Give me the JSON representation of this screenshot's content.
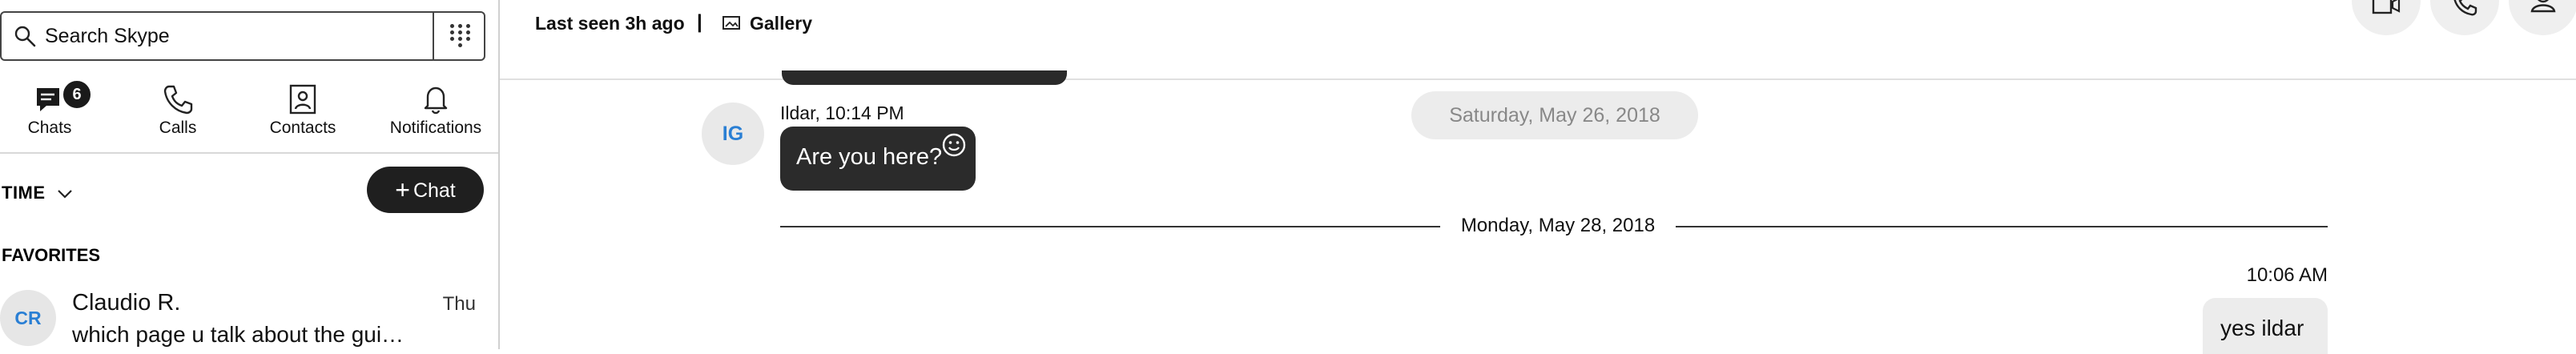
{
  "sidebar": {
    "search": {
      "placeholder": "Search Skype"
    },
    "nav": [
      {
        "label": "Chats",
        "icon": "chat-icon",
        "badge": "6"
      },
      {
        "label": "Calls",
        "icon": "phone-icon"
      },
      {
        "label": "Contacts",
        "icon": "contacts-icon"
      },
      {
        "label": "Notifications",
        "icon": "bell-icon"
      }
    ],
    "sort_label": "TIME",
    "new_chat_label": "Chat",
    "favorites_label": "FAVORITES",
    "favorites": [
      {
        "initials": "CR",
        "name": "Claudio R.",
        "time": "Thu",
        "preview": "which page u talk about the gui…"
      }
    ]
  },
  "conversation": {
    "header": {
      "last_seen": "Last seen 3h ago",
      "separator": "|",
      "gallery_label": "Gallery"
    },
    "messages": {
      "incoming": {
        "avatar_initials": "IG",
        "meta": "Ildar, 10:14 PM",
        "text": "Are you here?"
      },
      "date_pill": "Saturday, May 26, 2018",
      "date_divider": "Monday, May 28, 2018",
      "outgoing": {
        "time": "10:06 AM",
        "text": "yes ildar"
      }
    }
  },
  "colors": {
    "accent": "#2a7fd4",
    "bubble_dark": "#2b2b2b",
    "bubble_light": "#ececec"
  }
}
